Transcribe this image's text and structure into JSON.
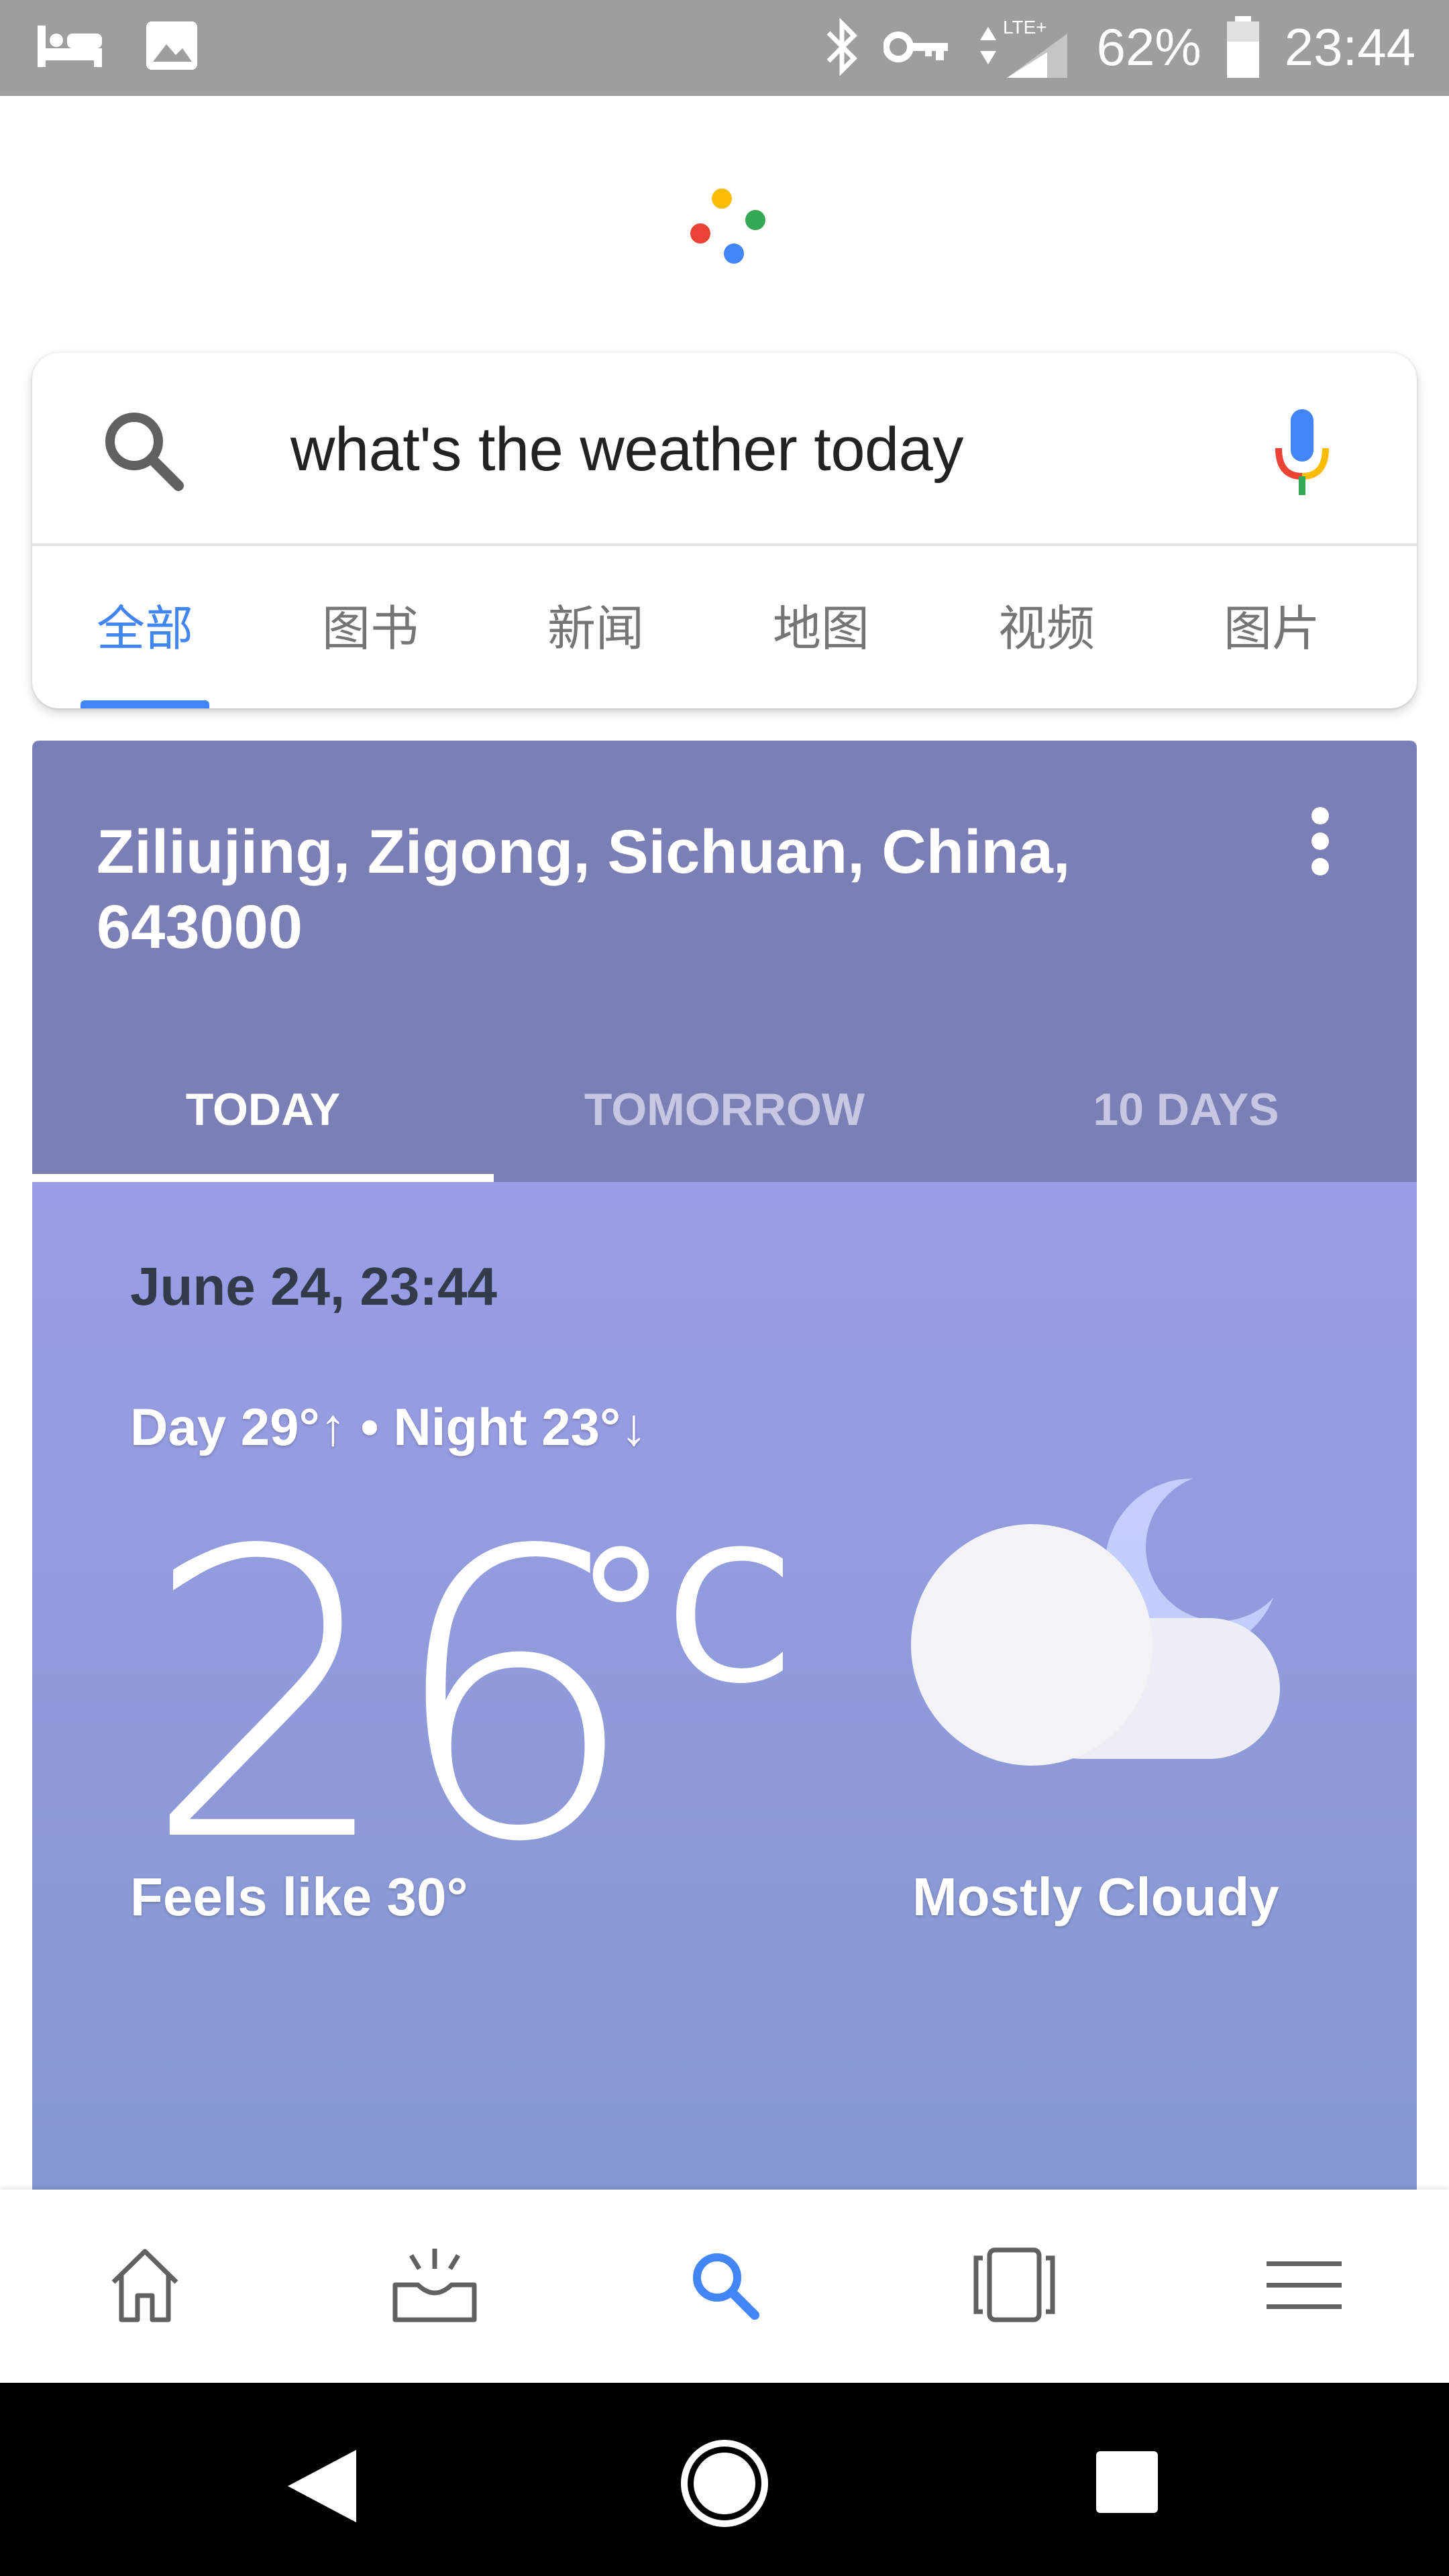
{
  "status_bar": {
    "left_icons": [
      "bed-icon",
      "image-icon"
    ],
    "right_icons": [
      "bluetooth-icon",
      "vpn-key-icon",
      "data-arrows-icon",
      "signal-icon",
      "battery-icon"
    ],
    "network_label": "LTE+",
    "battery_percent": "62%",
    "time": "23:44"
  },
  "search": {
    "query": "what's the weather today",
    "tabs": [
      {
        "label": "全部",
        "active": true
      },
      {
        "label": "图书",
        "active": false
      },
      {
        "label": "新闻",
        "active": false
      },
      {
        "label": "地图",
        "active": false
      },
      {
        "label": "视频",
        "active": false
      },
      {
        "label": "图片",
        "active": false
      }
    ]
  },
  "weather": {
    "location": "Ziliujing, Zigong, Sichuan, China, 643000",
    "tabs": [
      {
        "label": "TODAY",
        "active": true
      },
      {
        "label": "TOMORROW",
        "active": false
      },
      {
        "label": "10 DAYS",
        "active": false
      }
    ],
    "datetime": "June 24, 23:44",
    "day_night": "Day 29°↑ • Night 23°↓",
    "temperature": "26",
    "unit": "°C",
    "feels_like": "Feels like 30°",
    "condition": "Mostly Cloudy",
    "condition_icon": "mostly-cloudy-night-icon"
  },
  "bottom_nav": {
    "items": [
      "home-icon",
      "updates-icon",
      "search-icon",
      "recents-icon",
      "menu-icon"
    ],
    "active": "search-icon"
  },
  "colors": {
    "google_blue": "#4285f4",
    "google_red": "#ea4335",
    "google_yellow": "#fbbc05",
    "google_green": "#34a853",
    "weather_header": "#7b7fb5",
    "weather_body": "#9b9ee6"
  }
}
